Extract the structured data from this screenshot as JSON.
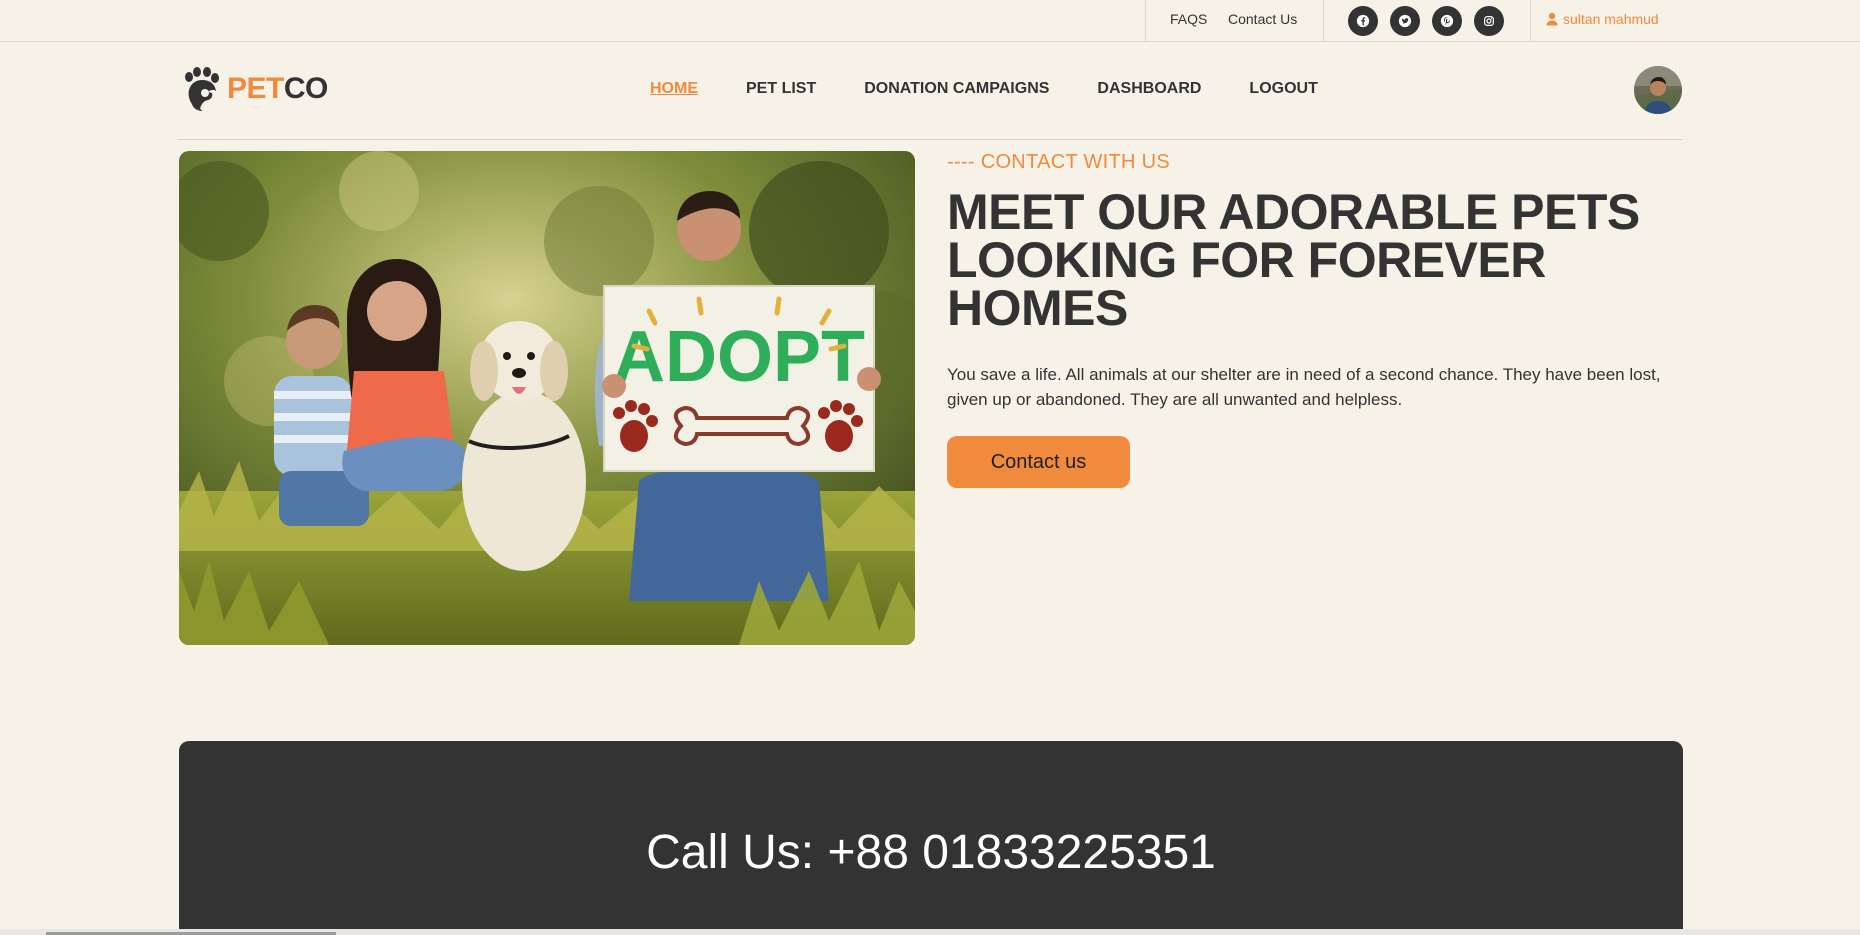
{
  "topbar": {
    "links": [
      {
        "label": "FAQS"
      },
      {
        "label": "Contact Us"
      }
    ],
    "social": [
      "facebook-icon",
      "twitter-icon",
      "pinterest-icon",
      "instagram-icon"
    ],
    "user": {
      "name": "sultan mahmud",
      "icon": "user-icon"
    }
  },
  "nav": {
    "logo": {
      "part1": "PET",
      "part2": "CO"
    },
    "menu": [
      {
        "label": "HOME",
        "active": true
      },
      {
        "label": "PET LIST"
      },
      {
        "label": "DONATION CAMPAIGNS"
      },
      {
        "label": "DASHBOARD"
      },
      {
        "label": "LOGOUT"
      }
    ]
  },
  "hero": {
    "eyebrow": "---- CONTACT WITH US",
    "headline": "MEET OUR ADORABLE PETS LOOKING FOR FOREVER HOMES",
    "description": "You save a life. All animals at our shelter are in need of a second chance. They have been lost, given up or abandoned. They are all unwanted and helpless.",
    "cta_label": "Contact us",
    "sign_text": "ADOPT"
  },
  "call": {
    "text": "Call Us: +88 01833225351"
  },
  "colors": {
    "accent": "#f08a3c",
    "dark": "#333333",
    "background": "#f6f2e8"
  }
}
